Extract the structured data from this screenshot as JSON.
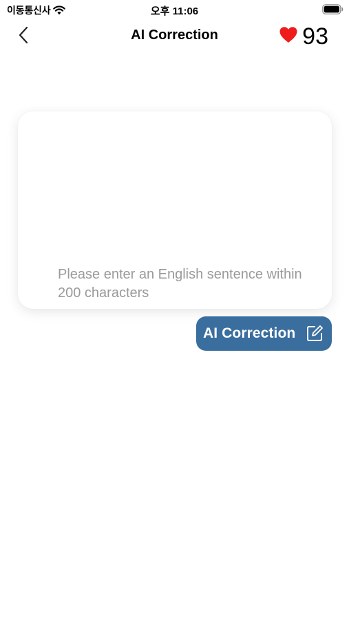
{
  "status_bar": {
    "carrier": "이동통신사",
    "time": "오후 11:06",
    "icons": [
      "wifi-icon",
      "battery-icon"
    ]
  },
  "nav": {
    "back_icon": "chevron-left-icon",
    "title": "AI Correction",
    "heart_icon": "heart-icon",
    "heart_count": "93"
  },
  "input": {
    "value": "",
    "placeholder": "Please enter an English sentence within 200 characters"
  },
  "action": {
    "label": "AI Correction",
    "icon": "edit-icon"
  },
  "colors": {
    "accent": "#3a6e9e",
    "heart": "#ee1c1c",
    "placeholder": "#9a9a9a"
  }
}
